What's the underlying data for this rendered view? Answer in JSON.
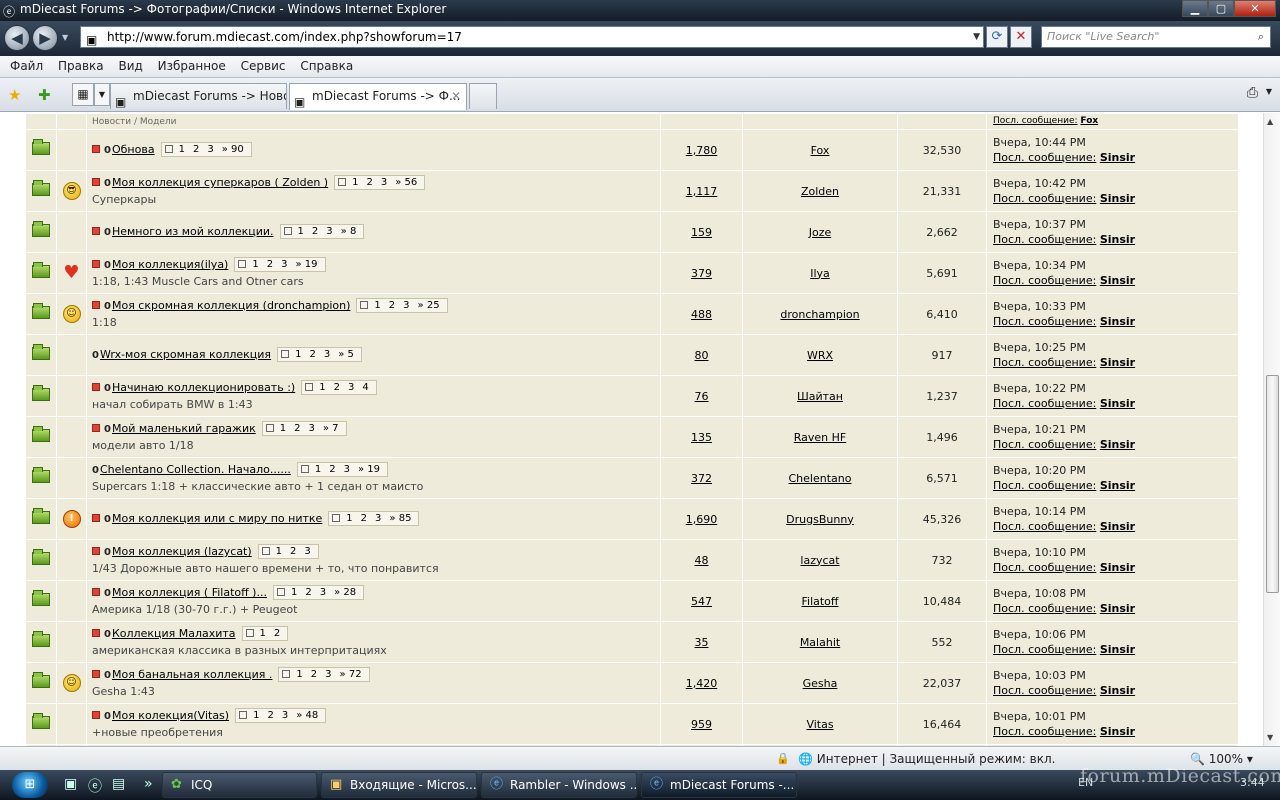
{
  "window": {
    "title": "mDiecast Forums -> Фотографии/Списки - Windows Internet Explorer",
    "minimize": "▁",
    "maximize": "▢",
    "close": "✕"
  },
  "browser": {
    "url": "http://www.forum.mdiecast.com/index.php?showforum=17",
    "search_placeholder": "Поиск \"Live Search\"",
    "menu": [
      "Файл",
      "Правка",
      "Вид",
      "Избранное",
      "Сервис",
      "Справка"
    ],
    "tabs": [
      {
        "label": "mDiecast Forums -> Ново..."
      },
      {
        "label": "mDiecast Forums -> Ф..."
      }
    ],
    "status": {
      "zone": "Интернет | Защищенный режим: вкл.",
      "zoom": "100%"
    }
  },
  "partial_row": {
    "last": "Посл. сообщение:",
    "user": "Fox",
    "desc": "Новости / Модели"
  },
  "topics": [
    {
      "title": "Обнова",
      "desc": "",
      "pages": [
        "1",
        "2",
        "3",
        "» 90"
      ],
      "replies": "1,780",
      "author": "Fox",
      "views": "32,530",
      "last_time": "Вчера, 10:44 PM",
      "last_user": "Sinsir",
      "emoticon": "",
      "prefix": true
    },
    {
      "title": "Моя коллекция суперкаров ( Zolden )",
      "desc": "Суперкары",
      "pages": [
        "1",
        "2",
        "3",
        "» 56"
      ],
      "replies": "1,117",
      "author": "Zolden",
      "views": "21,331",
      "last_time": "Вчера, 10:42 PM",
      "last_user": "Sinsir",
      "emoticon": "cool",
      "prefix": true
    },
    {
      "title": "Немного из мой коллекции.",
      "desc": "",
      "pages": [
        "1",
        "2",
        "3",
        "» 8"
      ],
      "replies": "159",
      "author": "Joze",
      "views": "2,662",
      "last_time": "Вчера, 10:37 PM",
      "last_user": "Sinsir",
      "emoticon": "",
      "prefix": true
    },
    {
      "title": "Моя коллекция(ilya)",
      "desc": "1:18, 1:43 Muscle Cars and Otner cars",
      "pages": [
        "1",
        "2",
        "3",
        "» 19"
      ],
      "replies": "379",
      "author": "Ilya",
      "views": "5,691",
      "last_time": "Вчера, 10:34 PM",
      "last_user": "Sinsir",
      "emoticon": "heart",
      "prefix": true
    },
    {
      "title": "Моя скромная коллекция (dronchampion)",
      "desc": "1:18",
      "pages": [
        "1",
        "2",
        "3",
        "» 25"
      ],
      "replies": "488",
      "author": "dronchampion",
      "views": "6,410",
      "last_time": "Вчера, 10:33 PM",
      "last_user": "Sinsir",
      "emoticon": "smile",
      "prefix": true
    },
    {
      "title": "Wrx-моя скромная коллекция",
      "desc": "",
      "pages": [
        "1",
        "2",
        "3",
        "» 5"
      ],
      "replies": "80",
      "author": "WRX",
      "views": "917",
      "last_time": "Вчера, 10:25 PM",
      "last_user": "Sinsir",
      "emoticon": "",
      "prefix": false
    },
    {
      "title": "Начинаю коллекционировать :)",
      "desc": "начал собирать BMW в 1:43",
      "pages": [
        "1",
        "2",
        "3",
        "4"
      ],
      "replies": "76",
      "author": "Шайтан",
      "views": "1,237",
      "last_time": "Вчера, 10:22 PM",
      "last_user": "Sinsir",
      "emoticon": "",
      "prefix": true
    },
    {
      "title": "Мой маленький гаражик",
      "desc": "модели авто 1/18",
      "pages": [
        "1",
        "2",
        "3",
        "» 7"
      ],
      "replies": "135",
      "author": "Raven HF",
      "views": "1,496",
      "last_time": "Вчера, 10:21 PM",
      "last_user": "Sinsir",
      "emoticon": "",
      "prefix": true
    },
    {
      "title": "Chelentano Collection. Начало......",
      "desc": "Supercars 1:18 + классические авто + 1 седан от маисто",
      "pages": [
        "1",
        "2",
        "3",
        "» 19"
      ],
      "replies": "372",
      "author": "Chelentano",
      "views": "6,571",
      "last_time": "Вчера, 10:20 PM",
      "last_user": "Sinsir",
      "emoticon": "",
      "prefix": false
    },
    {
      "title": "Моя коллекция или с миру по нитке",
      "desc": "",
      "pages": [
        "1",
        "2",
        "3",
        "» 85"
      ],
      "replies": "1,690",
      "author": "DrugsBunny",
      "views": "45,326",
      "last_time": "Вчера, 10:14 PM",
      "last_user": "Sinsir",
      "emoticon": "warn",
      "prefix": true
    },
    {
      "title": "Моя коллекция (lazycat)",
      "desc": "1/43 Дорожные авто нашего времени + то, что понравится",
      "pages": [
        "1",
        "2",
        "3"
      ],
      "replies": "48",
      "author": "lazycat",
      "views": "732",
      "last_time": "Вчера, 10:10 PM",
      "last_user": "Sinsir",
      "emoticon": "",
      "prefix": true
    },
    {
      "title": "Моя коллекция ( Filatoff )...",
      "desc": "Америка 1/18 (30-70 г.г.) + Peugeot",
      "pages": [
        "1",
        "2",
        "3",
        "» 28"
      ],
      "replies": "547",
      "author": "Filatoff",
      "views": "10,484",
      "last_time": "Вчера, 10:08 PM",
      "last_user": "Sinsir",
      "emoticon": "",
      "prefix": true
    },
    {
      "title": "Коллекция Малахита",
      "desc": "американская классика в разных интерпритациях",
      "pages": [
        "1",
        "2"
      ],
      "replies": "35",
      "author": "Malahit",
      "views": "552",
      "last_time": "Вчера, 10:06 PM",
      "last_user": "Sinsir",
      "emoticon": "",
      "prefix": true
    },
    {
      "title": "Моя банальная коллекция .",
      "desc": "Gesha 1:43",
      "pages": [
        "1",
        "2",
        "3",
        "» 72"
      ],
      "replies": "1,420",
      "author": "Gesha",
      "views": "22,037",
      "last_time": "Вчера, 10:03 PM",
      "last_user": "Sinsir",
      "emoticon": "smile",
      "prefix": true
    },
    {
      "title": "Моя колекция(Vitas)",
      "desc": "+новые преобретения",
      "pages": [
        "1",
        "2",
        "3",
        "» 48"
      ],
      "replies": "959",
      "author": "Vitas",
      "views": "16,464",
      "last_time": "Вчера, 10:01 PM",
      "last_user": "Sinsir",
      "emoticon": "",
      "prefix": true
    }
  ],
  "labels": {
    "last_post": "Посл. сообщение:",
    "zero_marker": "0"
  },
  "taskbar": {
    "start": "⊞",
    "buttons": [
      {
        "label": "ICQ",
        "icon": "icq-icon"
      },
      {
        "label": "Входящие - Micros...",
        "icon": "outlook-icon"
      },
      {
        "label": "Rambler - Windows ...",
        "icon": "ie-icon"
      },
      {
        "label": "mDiecast Forums -...",
        "icon": "ie-icon"
      }
    ],
    "tray": "EN",
    "clock": "3:44"
  },
  "watermark": "forum.mDiecast.com",
  "colors": {
    "row_bg": "#efebdb",
    "titlebar": "#1c2836",
    "link": "#000000"
  }
}
